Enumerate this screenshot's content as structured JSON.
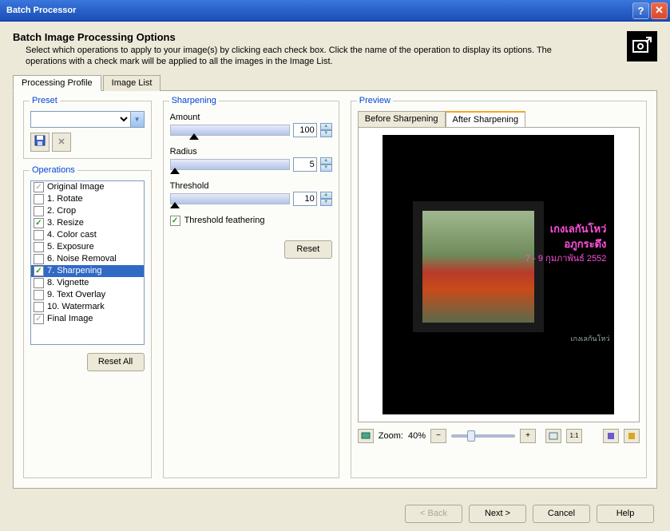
{
  "window": {
    "title": "Batch Processor"
  },
  "header": {
    "title": "Batch Image Processing Options",
    "desc": "Select which operations to apply to your image(s) by clicking each check box.  Click the name of the operation to display its options.  The operations with a check mark will be applied to all the images in the Image List."
  },
  "tabs": {
    "profile": "Processing Profile",
    "imagelist": "Image List"
  },
  "preset": {
    "legend": "Preset",
    "value": ""
  },
  "operations": {
    "legend": "Operations",
    "items": [
      {
        "label": "Original Image",
        "checked": true,
        "dim": true
      },
      {
        "label": "1. Rotate",
        "checked": false
      },
      {
        "label": "2. Crop",
        "checked": false
      },
      {
        "label": "3. Resize",
        "checked": true
      },
      {
        "label": "4. Color cast",
        "checked": false
      },
      {
        "label": "5. Exposure",
        "checked": false
      },
      {
        "label": "6. Noise Removal",
        "checked": false
      },
      {
        "label": "7. Sharpening",
        "checked": true,
        "selected": true
      },
      {
        "label": "8. Vignette",
        "checked": false
      },
      {
        "label": "9. Text Overlay",
        "checked": false
      },
      {
        "label": "10. Watermark",
        "checked": false
      },
      {
        "label": "Final Image",
        "checked": true,
        "dim": true
      }
    ],
    "resetall": "Reset All"
  },
  "sharpening": {
    "legend": "Sharpening",
    "amount": {
      "label": "Amount",
      "value": "100",
      "pos": 20
    },
    "radius": {
      "label": "Radius",
      "value": "5",
      "pos": 4
    },
    "threshold": {
      "label": "Threshold",
      "value": "10",
      "pos": 4
    },
    "feather": "Threshold feathering",
    "reset": "Reset"
  },
  "preview": {
    "legend": "Preview",
    "tab_before": "Before Sharpening",
    "tab_after": "After Sharpening",
    "overlay1": "เกงเลกันโหว่",
    "overlay2": "อภูกระดึง",
    "overlay3": "7 - 9 กุมภาพันธ์ 2552",
    "corner": "เกงเลกันโหว่",
    "zoom_label": "Zoom:",
    "zoom_value": "40%"
  },
  "footer": {
    "back": "< Back",
    "next": "Next >",
    "cancel": "Cancel",
    "help": "Help"
  }
}
